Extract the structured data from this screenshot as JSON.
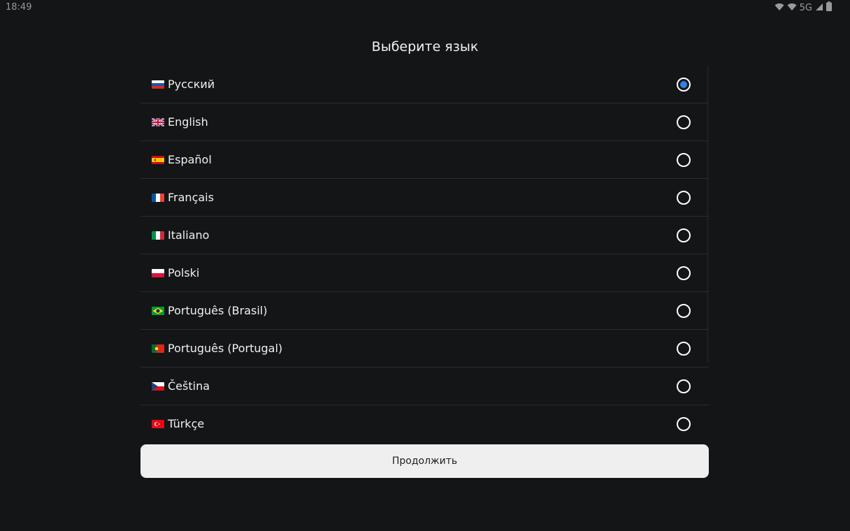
{
  "status_bar": {
    "time": "18:49",
    "network": "5G",
    "icons": [
      "wifi-icon",
      "wifi-icon",
      "signal-icon",
      "battery-icon"
    ]
  },
  "title": "Выберите язык",
  "languages": [
    {
      "label": "Русский",
      "flag": "ru",
      "selected": true
    },
    {
      "label": "English",
      "flag": "gb",
      "selected": false
    },
    {
      "label": "Español",
      "flag": "es",
      "selected": false
    },
    {
      "label": "Français",
      "flag": "fr",
      "selected": false
    },
    {
      "label": "Italiano",
      "flag": "it",
      "selected": false
    },
    {
      "label": "Polski",
      "flag": "pl",
      "selected": false
    },
    {
      "label": "Português (Brasil)",
      "flag": "br",
      "selected": false
    },
    {
      "label": "Português (Portugal)",
      "flag": "pt",
      "selected": false
    },
    {
      "label": "Čeština",
      "flag": "cz",
      "selected": false
    },
    {
      "label": "Türkçe",
      "flag": "tr",
      "selected": false
    }
  ],
  "continue_label": "Продолжить",
  "colors": {
    "background": "#141517",
    "accent": "#2f80ed",
    "button_bg": "#efefef"
  }
}
